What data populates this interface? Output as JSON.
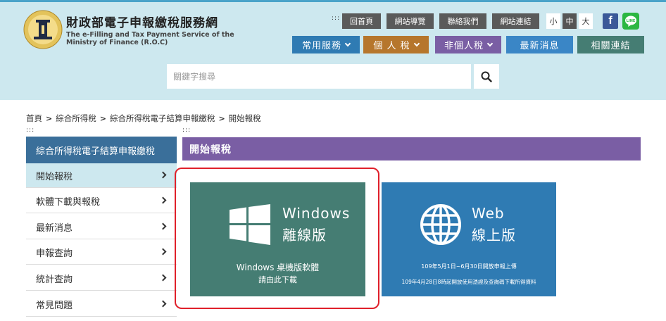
{
  "header": {
    "site_name": "財政部電子申報繳稅服務網",
    "site_sub_line1": "The e-Filling and Tax Payment Service of the",
    "site_sub_line2": "Ministry of Finance (R.O.C)",
    "dots": ":::",
    "util_links": [
      "回首頁",
      "網站導覽",
      "聯絡我們",
      "網站連結"
    ],
    "font_sizes": [
      "小",
      "中",
      "大"
    ],
    "facebook_label": "f",
    "line_label": "LINE",
    "nav": [
      {
        "label": "常用服務",
        "color": "#2f7bb3",
        "has_dropdown": true
      },
      {
        "label": "個 人 稅",
        "color": "#b6762c",
        "has_dropdown": true
      },
      {
        "label": "非個人稅",
        "color": "#7a5ea4",
        "has_dropdown": true
      },
      {
        "label": "最新消息",
        "color": "#3a86c6",
        "has_dropdown": false
      },
      {
        "label": "相關連結",
        "color": "#457d73",
        "has_dropdown": false
      }
    ],
    "search_placeholder": "關鍵字搜尋"
  },
  "breadcrumb": [
    "首頁",
    "綜合所得稅",
    "綜合所得稅電子結算申報繳稅",
    "開始報稅"
  ],
  "dots_left": ":::",
  "dots_right": ":::",
  "sidebar": {
    "title": "綜合所得稅電子結算申報繳稅",
    "items": [
      {
        "label": "開始報稅",
        "active": true
      },
      {
        "label": "軟體下載與報稅",
        "active": false
      },
      {
        "label": "最新消息",
        "active": false
      },
      {
        "label": "申報查詢",
        "active": false
      },
      {
        "label": "統計查詢",
        "active": false
      },
      {
        "label": "常見問題",
        "active": false
      }
    ]
  },
  "main": {
    "title": "開始報稅",
    "windows_card": {
      "title_line1": "Windows",
      "title_line2": "離線版",
      "desc_line1": "Windows 桌機版軟體",
      "desc_line2": "請由此下載"
    },
    "web_card": {
      "title_line1": "Web",
      "title_line2": "線上版",
      "desc_line1": "109年5月1日~6月30日開放申報上傳",
      "desc_line2": "109年4月28日8時起開放使用憑證及查詢碼下載所得資料"
    }
  }
}
